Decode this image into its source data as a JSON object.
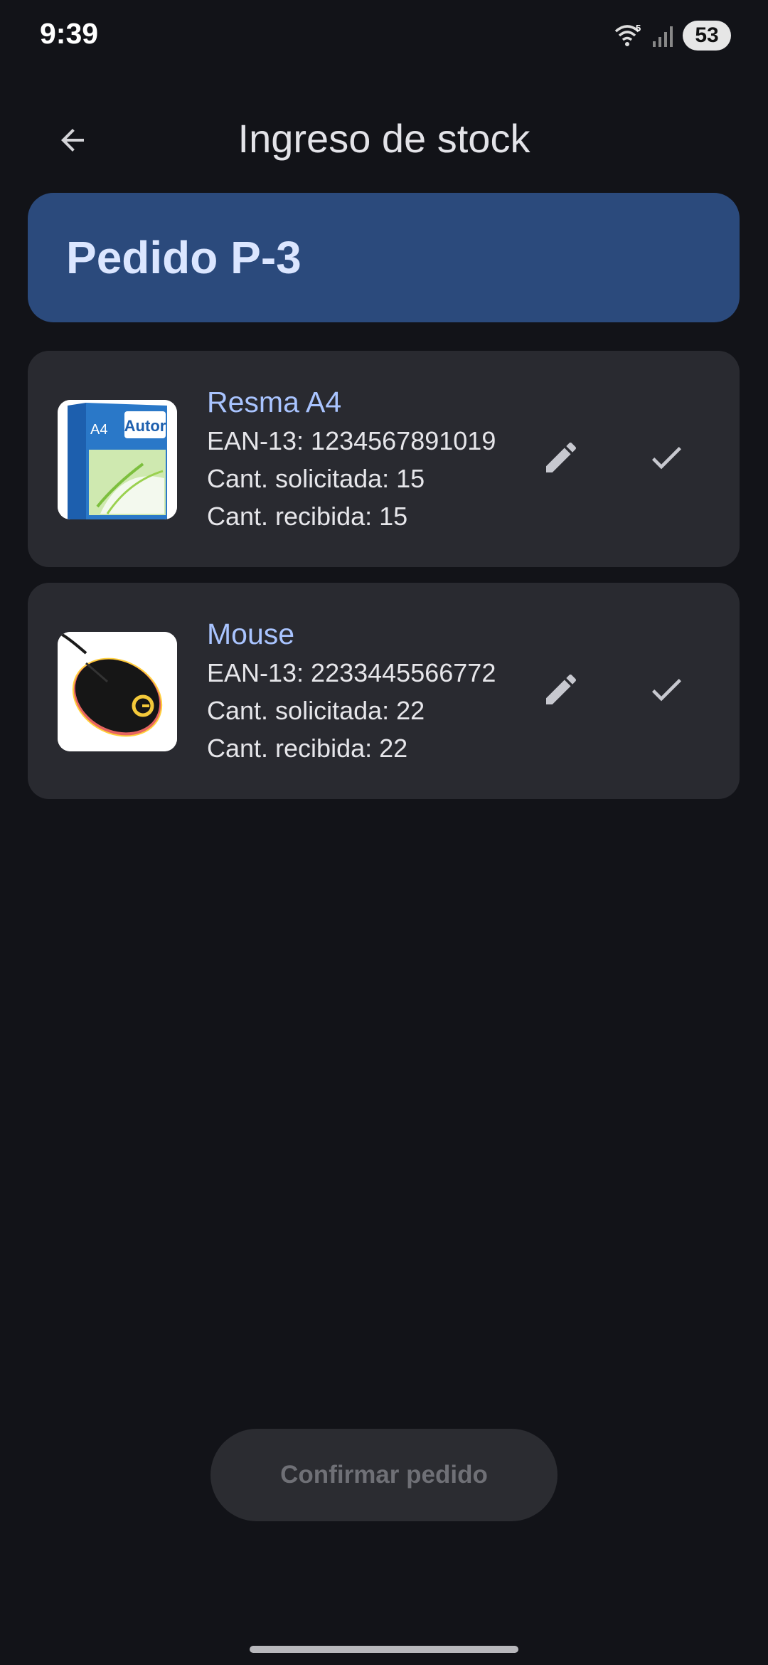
{
  "status_bar": {
    "time": "9:39",
    "wifi_badge": "5",
    "battery": "53"
  },
  "app_bar": {
    "title": "Ingreso de stock",
    "back_icon": "arrow-back-icon"
  },
  "order": {
    "title": "Pedido P-3"
  },
  "items": [
    {
      "name": "Resma A4",
      "ean": "EAN-13: 1234567891019",
      "requested": "Cant. solicitada: 15",
      "received": "Cant. recibida: 15",
      "thumb_brand": "Autor",
      "thumb_size": "A4",
      "edit_icon": "pencil-icon",
      "check_icon": "check-icon"
    },
    {
      "name": "Mouse",
      "ean": "EAN-13: 2233445566772",
      "requested": "Cant. solicitada: 22",
      "received": "Cant. recibida: 22",
      "edit_icon": "pencil-icon",
      "check_icon": "check-icon"
    }
  ],
  "actions": {
    "confirm_label": "Confirmar pedido"
  },
  "colors": {
    "background": "#121318",
    "order_header": "#2b4a7c",
    "card": "#292a30",
    "item_name": "#a9c4ff"
  }
}
